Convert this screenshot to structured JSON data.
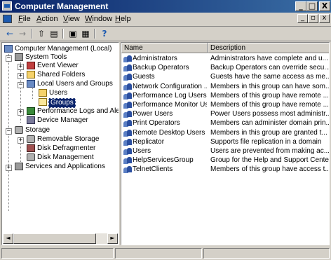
{
  "window": {
    "title": "Computer Management",
    "buttons": {
      "minimize": "_",
      "maximize": "□",
      "close": "X"
    }
  },
  "menubar": {
    "items": [
      {
        "label": "File",
        "accel": "F",
        "rest": "ile"
      },
      {
        "label": "Action",
        "accel": "A",
        "rest": "ction"
      },
      {
        "label": "View",
        "accel": "V",
        "rest": "iew"
      },
      {
        "label": "Window",
        "accel": "W",
        "rest": "indow"
      },
      {
        "label": "Help",
        "accel": "H",
        "rest": "elp"
      }
    ],
    "mdi_buttons": {
      "minimize": "_",
      "restore": "▫",
      "close": "x"
    }
  },
  "toolbar": {
    "back": "←",
    "forward": "→",
    "up": "⇧",
    "show_hide_tree": "▤",
    "properties": "▣",
    "export": "▦",
    "help": "?"
  },
  "tree": {
    "root": "Computer Management (Local)",
    "system_tools": "System Tools",
    "event_viewer": "Event Viewer",
    "shared_folders": "Shared Folders",
    "local_users_groups": "Local Users and Groups",
    "users": "Users",
    "groups": "Groups",
    "perf_logs": "Performance Logs and Alerts",
    "device_manager": "Device Manager",
    "storage": "Storage",
    "removable_storage": "Removable Storage",
    "disk_defrag": "Disk Defragmenter",
    "disk_management": "Disk Management",
    "services_apps": "Services and Applications",
    "expander_plus": "+",
    "expander_minus": "−"
  },
  "list": {
    "columns": {
      "name": "Name",
      "description": "Description"
    },
    "rows": [
      {
        "name": "Administrators",
        "description": "Administrators have complete and u..."
      },
      {
        "name": "Backup Operators",
        "description": "Backup Operators can override secu..."
      },
      {
        "name": "Guests",
        "description": "Guests have the same access as me..."
      },
      {
        "name": "Network Configuration ...",
        "description": "Members in this group can have som..."
      },
      {
        "name": "Performance Log Users",
        "description": "Members of this group have remote ..."
      },
      {
        "name": "Performance Monitor Us...",
        "description": "Members of this group have remote ..."
      },
      {
        "name": "Power Users",
        "description": "Power Users possess most administr..."
      },
      {
        "name": "Print Operators",
        "description": "Members can administer domain prin..."
      },
      {
        "name": "Remote Desktop Users",
        "description": "Members in this group are granted t..."
      },
      {
        "name": "Replicator",
        "description": "Supports file replication in a domain"
      },
      {
        "name": "Users",
        "description": "Users are prevented from making ac..."
      },
      {
        "name": "HelpServicesGroup",
        "description": "Group for the Help and Support Center"
      },
      {
        "name": "TelnetClients",
        "description": "Members of this group have access t..."
      }
    ]
  },
  "scroll": {
    "left": "◄",
    "right": "►"
  },
  "colors": {
    "title_active": "#0a246a",
    "selection": "#0a246a",
    "face": "#d4d0c8"
  }
}
